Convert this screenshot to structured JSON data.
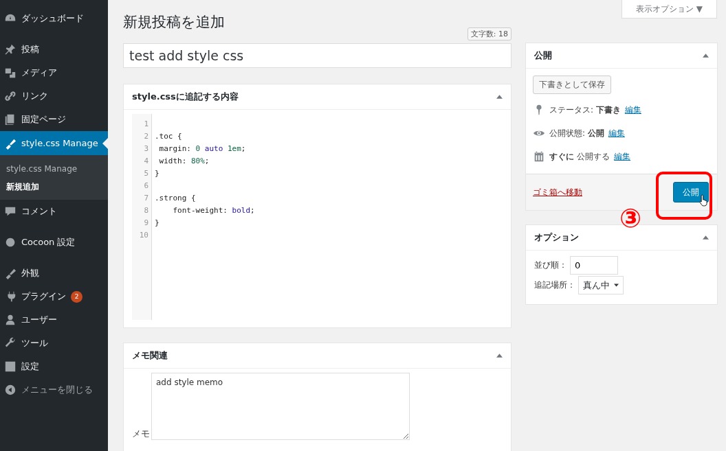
{
  "sidebar": {
    "items": [
      {
        "label": "ダッシュボード",
        "selected": false,
        "gap_after": true
      },
      {
        "label": "投稿",
        "selected": false
      },
      {
        "label": "メディア",
        "selected": false
      },
      {
        "label": "リンク",
        "selected": false
      },
      {
        "label": "固定ページ",
        "selected": false
      },
      {
        "label": "style.css Manage",
        "selected": true,
        "submenu": [
          {
            "label": "style.css Manage",
            "selected": false
          },
          {
            "label": "新規追加",
            "selected": true
          }
        ]
      },
      {
        "label": "コメント",
        "selected": false,
        "gap_after": true
      },
      {
        "label": "Cocoon 設定",
        "selected": false,
        "gap_after": true
      },
      {
        "label": "外観",
        "selected": false
      },
      {
        "label": "プラグイン",
        "selected": false,
        "badge": "2"
      },
      {
        "label": "ユーザー",
        "selected": false
      },
      {
        "label": "ツール",
        "selected": false
      },
      {
        "label": "設定",
        "selected": false
      },
      {
        "label": "メニューを閉じる",
        "selected": false,
        "kind": "collapse"
      }
    ]
  },
  "screen_options": "表示オプション ▼",
  "page_title": "新規投稿を追加",
  "word_count": "文字数: 18",
  "post_title": "test add style css",
  "code_box": {
    "title": "style.cssに追記する内容",
    "lines": [
      {
        "num": "1"
      },
      {
        "num": "2",
        "tokens": [
          {
            "text": ".toc {",
            "kind": "plain"
          }
        ]
      },
      {
        "num": "3",
        "tokens": [
          {
            "text": " margin: ",
            "kind": "plain"
          },
          {
            "text": "0",
            "kind": "number"
          },
          {
            "text": " auto ",
            "kind": "keyword"
          },
          {
            "text": "1em",
            "kind": "number"
          },
          {
            "text": ";",
            "kind": "plain"
          }
        ]
      },
      {
        "num": "4",
        "tokens": [
          {
            "text": " width: ",
            "kind": "plain"
          },
          {
            "text": "80%",
            "kind": "number"
          },
          {
            "text": ";",
            "kind": "plain"
          }
        ]
      },
      {
        "num": "5",
        "tokens": [
          {
            "text": "}",
            "kind": "plain"
          }
        ]
      },
      {
        "num": "6"
      },
      {
        "num": "7",
        "tokens": [
          {
            "text": ".strong {",
            "kind": "plain"
          }
        ]
      },
      {
        "num": "8",
        "tokens": [
          {
            "text": "    font-weight: ",
            "kind": "plain"
          },
          {
            "text": "bold",
            "kind": "keyword"
          },
          {
            "text": ";",
            "kind": "plain"
          }
        ]
      },
      {
        "num": "9",
        "tokens": [
          {
            "text": "}",
            "kind": "plain"
          }
        ]
      },
      {
        "num": "10"
      }
    ]
  },
  "memo_box": {
    "title": "メモ関連",
    "label": "メモ",
    "value": "add style memo"
  },
  "publish_box": {
    "title": "公開",
    "save_draft": "下書きとして保存",
    "rows": [
      {
        "label": "ステータス:",
        "value": "下書き",
        "link": "編集"
      },
      {
        "label": "公開状態:",
        "value": "公開",
        "link": "編集"
      },
      {
        "label": "すぐに",
        "value": "公開する",
        "link": "編集",
        "kind": "schedule"
      }
    ],
    "trash": "ゴミ箱へ移動",
    "publish": "公開"
  },
  "annotation": "③",
  "options_box": {
    "title": "オプション",
    "order_label": "並び順：",
    "order_value": "0",
    "place_label": "追記場所：",
    "place_value": "真ん中"
  }
}
